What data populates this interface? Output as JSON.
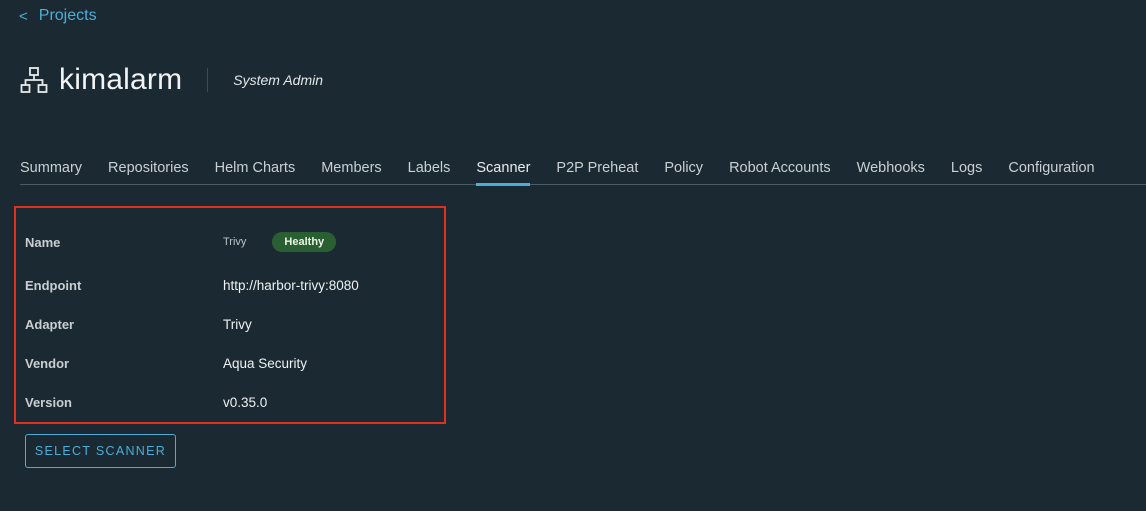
{
  "nav": {
    "back_chevron": "<",
    "back_label": "Projects"
  },
  "header": {
    "icon": "project-hierarchy-icon",
    "title": "kimalarm",
    "role": "System Admin"
  },
  "tabs": [
    {
      "label": "Summary",
      "active": false
    },
    {
      "label": "Repositories",
      "active": false
    },
    {
      "label": "Helm Charts",
      "active": false
    },
    {
      "label": "Members",
      "active": false
    },
    {
      "label": "Labels",
      "active": false
    },
    {
      "label": "Scanner",
      "active": true
    },
    {
      "label": "P2P Preheat",
      "active": false
    },
    {
      "label": "Policy",
      "active": false
    },
    {
      "label": "Robot Accounts",
      "active": false
    },
    {
      "label": "Webhooks",
      "active": false
    },
    {
      "label": "Logs",
      "active": false
    },
    {
      "label": "Configuration",
      "active": false
    }
  ],
  "scanner": {
    "name_label": "Name",
    "name_value": "Trivy",
    "health_badge": "Healthy",
    "endpoint_label": "Endpoint",
    "endpoint_value": "http://harbor-trivy:8080",
    "adapter_label": "Adapter",
    "adapter_value": "Trivy",
    "vendor_label": "Vendor",
    "vendor_value": "Aqua Security",
    "version_label": "Version",
    "version_value": "v0.35.0"
  },
  "actions": {
    "select_scanner_label": "SELECT SCANNER"
  },
  "colors": {
    "background": "#1b2a32",
    "accent": "#4aaed9",
    "highlight_border": "#e0301e",
    "healthy_badge": "#2a5f33"
  }
}
